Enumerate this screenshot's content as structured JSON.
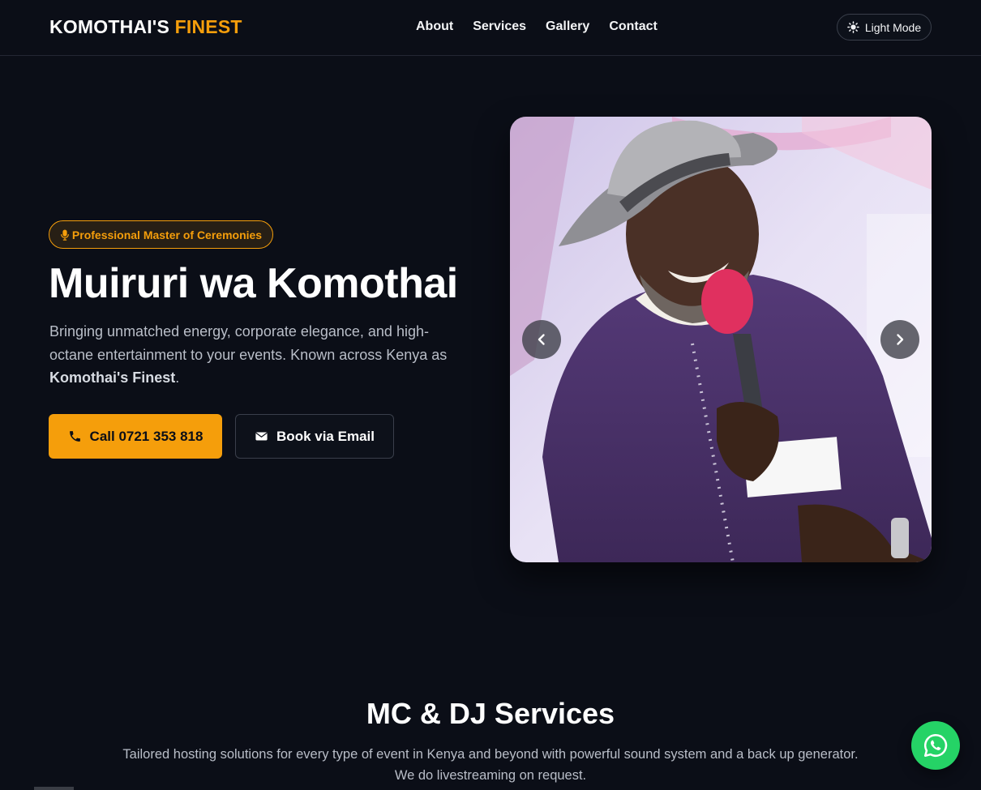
{
  "header": {
    "logo_main": "KOMOTHAI'S",
    "logo_accent": "FINEST",
    "nav": [
      "About",
      "Services",
      "Gallery",
      "Contact"
    ],
    "mode_toggle_label": "Light Mode"
  },
  "hero": {
    "badge": "Professional Master of Ceremonies",
    "title": "Muiruri wa Komothai",
    "description": "Bringing unmatched energy, corporate elegance, and high-octane entertainment to your events. Known across Kenya as",
    "description_highlight": "Komothai's Finest",
    "description_end": ".",
    "call_button": "Call 0721 353 818",
    "email_button": "Book via Email"
  },
  "services": {
    "title": "MC & DJ Services",
    "description_line1": "Tailored hosting solutions for every type of event in Kenya and beyond with powerful sound system and a back up generator.",
    "description_line2": "We do livestreaming on request."
  },
  "icons": {
    "mode_toggle": "sun-icon",
    "badge": "microphone-icon",
    "call": "phone-icon",
    "email": "envelope-icon",
    "carousel_prev": "chevron-left-icon",
    "carousel_next": "chevron-right-icon",
    "whatsapp": "whatsapp-icon"
  },
  "colors": {
    "background": "#0b0e17",
    "accent": "#f59e0b",
    "whatsapp": "#25d366"
  }
}
